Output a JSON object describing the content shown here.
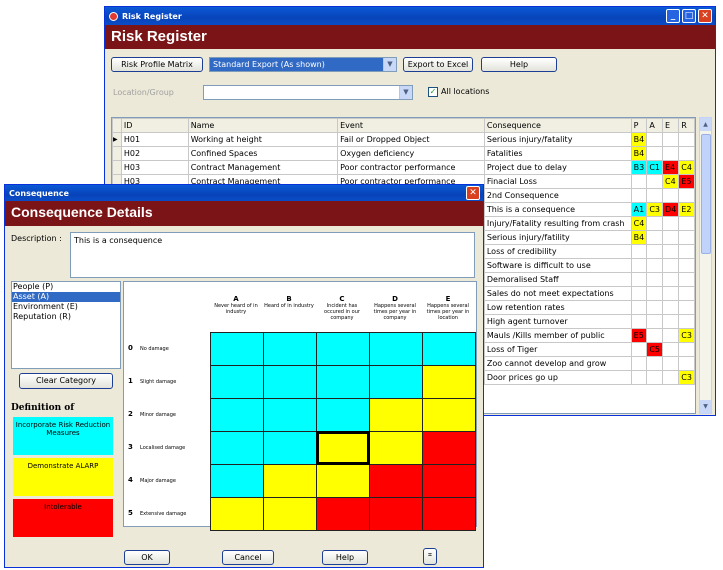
{
  "risk_register": {
    "window_title": "Risk Register",
    "banner": "Risk Register",
    "toolbar": {
      "profile_matrix": "Risk Profile Matrix",
      "export_select": "Standard Export (As shown)",
      "export_excel": "Export to Excel",
      "help": "Help"
    },
    "location_label": "Location/Group",
    "location_value": "",
    "all_locations": "All locations",
    "columns": [
      "ID",
      "Name",
      "Event",
      "Consequence",
      "P",
      "A",
      "E",
      "R"
    ],
    "rows": [
      {
        "id": "H01",
        "name": "Working at height",
        "event": "Fail or Dropped Object",
        "consequence": "Serious injury/fatality",
        "p": "B4",
        "a": "",
        "e": "",
        "r": ""
      },
      {
        "id": "H02",
        "name": "Confined Spaces",
        "event": "Oxygen deficiency",
        "consequence": "Fatalities",
        "p": "B4",
        "a": "",
        "e": "",
        "r": ""
      },
      {
        "id": "H03",
        "name": "Contract Management",
        "event": "Poor contractor performance",
        "consequence": "Project due to delay",
        "p": "B3",
        "a": "C1",
        "e": "E4",
        "r": "C4"
      },
      {
        "id": "H03",
        "name": "Contract Management",
        "event": "Poor contractor performance",
        "consequence": "Finacial Loss",
        "p": "",
        "a": "",
        "e": "C4",
        "r": "E5"
      },
      {
        "id": "",
        "name": "",
        "event": "",
        "consequence": "2nd Consequence",
        "p": "",
        "a": "",
        "e": "",
        "r": ""
      },
      {
        "id": "",
        "name": "",
        "event": "",
        "consequence": "This is a consequence",
        "p": "A1",
        "a": "C3",
        "e": "D4",
        "r": "E2"
      },
      {
        "id": "",
        "name": "",
        "event": "",
        "consequence": "Injury/Fatality resulting from crash",
        "p": "C4",
        "a": "",
        "e": "",
        "r": ""
      },
      {
        "id": "",
        "name": "",
        "event": "",
        "consequence": "Serious injury/fatility",
        "p": "B4",
        "a": "",
        "e": "",
        "r": ""
      },
      {
        "id": "",
        "name": "",
        "event": "",
        "consequence": "Loss of credibility",
        "p": "",
        "a": "",
        "e": "",
        "r": ""
      },
      {
        "id": "",
        "name": "",
        "event": "",
        "consequence": "Software is difficult to use",
        "p": "",
        "a": "",
        "e": "",
        "r": ""
      },
      {
        "id": "",
        "name": "",
        "event": "",
        "consequence": "Demoralised Staff",
        "p": "",
        "a": "",
        "e": "",
        "r": ""
      },
      {
        "id": "",
        "name": "",
        "event": "",
        "consequence": "Sales do not meet expectations",
        "p": "",
        "a": "",
        "e": "",
        "r": ""
      },
      {
        "id": "",
        "name": "",
        "event": "",
        "consequence": "Low retention rates",
        "p": "",
        "a": "",
        "e": "",
        "r": ""
      },
      {
        "id": "",
        "name": "",
        "event": "",
        "consequence": "High agent turnover",
        "p": "",
        "a": "",
        "e": "",
        "r": ""
      },
      {
        "id": "",
        "name": "",
        "event": "",
        "consequence": "Mauls /Kills member of public",
        "p": "E5",
        "a": "",
        "e": "",
        "r": "C3"
      },
      {
        "id": "",
        "name": "",
        "event": "",
        "consequence": "Loss of Tiger",
        "p": "",
        "a": "C5",
        "e": "",
        "r": ""
      },
      {
        "id": "",
        "name": "",
        "event": "",
        "consequence": "Zoo cannot develop and grow",
        "p": "",
        "a": "",
        "e": "",
        "r": ""
      },
      {
        "id": "",
        "name": "",
        "event": "",
        "consequence": "Door prices go up",
        "p": "",
        "a": "",
        "e": "",
        "r": "C3"
      }
    ],
    "cell_colors": {
      "A1": "#00FFFF",
      "B3": "#00FFFF",
      "C1": "#00FFFF",
      "B4": "#FFFF00",
      "C3": "#FFFF00",
      "C4": "#FFFF00",
      "E2": "#FFFF00",
      "C5": "#FF0000",
      "D4": "#FF0000",
      "E4": "#FF0000",
      "E5": "#FF0000"
    }
  },
  "consequence": {
    "window_title": "Consequence",
    "banner": "Consequence Details",
    "description_label": "Description :",
    "description_value": "This is a consequence",
    "categories": [
      "People (P)",
      "Asset (A)",
      "Environment (E)",
      "Reputation (R)"
    ],
    "selected_category": "Asset (A)",
    "clear_category": "Clear Category",
    "definition_title": "Definition of",
    "definitions": [
      {
        "label": "Incorporate Risk Reduction Measures",
        "color": "#00FFFF"
      },
      {
        "label": "Demonstrate ALARP",
        "color": "#FFFF00"
      },
      {
        "label": "Intolerable",
        "color": "#FF0000"
      }
    ],
    "matrix": {
      "columns": [
        {
          "letter": "A",
          "text": "Never heard of in industry"
        },
        {
          "letter": "B",
          "text": "Heard of in industry"
        },
        {
          "letter": "C",
          "text": "Incident has occured in our company"
        },
        {
          "letter": "D",
          "text": "Happens several times per year in company"
        },
        {
          "letter": "E",
          "text": "Happens several times per year in location"
        }
      ],
      "rows": [
        {
          "num": "0",
          "text": "No damage"
        },
        {
          "num": "1",
          "text": "Slight damage"
        },
        {
          "num": "2",
          "text": "Minor damage"
        },
        {
          "num": "3",
          "text": "Localised damage"
        },
        {
          "num": "4",
          "text": "Major damage"
        },
        {
          "num": "5",
          "text": "Extensive damage"
        }
      ],
      "cells": [
        [
          "cyan",
          "cyan",
          "cyan",
          "cyan",
          "cyan"
        ],
        [
          "cyan",
          "cyan",
          "cyan",
          "cyan",
          "yellow"
        ],
        [
          "cyan",
          "cyan",
          "cyan",
          "yellow",
          "yellow"
        ],
        [
          "cyan",
          "cyan",
          "yellow",
          "yellow",
          "red"
        ],
        [
          "cyan",
          "yellow",
          "yellow",
          "red",
          "red"
        ],
        [
          "yellow",
          "yellow",
          "red",
          "red",
          "red"
        ]
      ],
      "selected_cell": "C3",
      "palette": {
        "cyan": "#00FFFF",
        "yellow": "#FFFF00",
        "red": "#FF0000"
      }
    },
    "buttons": {
      "ok": "OK",
      "cancel": "Cancel",
      "help": "Help"
    }
  }
}
